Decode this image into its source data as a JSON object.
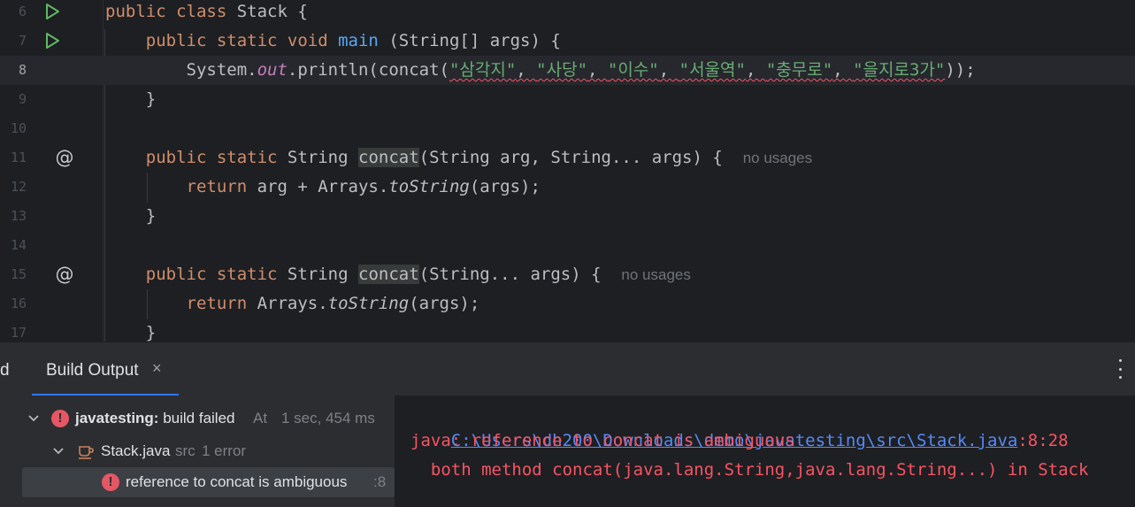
{
  "editor": {
    "lines": [
      {
        "num": "6",
        "gutter": "run",
        "parts": [
          [
            "kw",
            "public class "
          ],
          [
            "plain",
            "Stack {"
          ]
        ]
      },
      {
        "num": "7",
        "gutter": "run",
        "parts": [
          [
            "plain",
            "    "
          ],
          [
            "kw",
            "public static void "
          ],
          [
            "fn",
            "main "
          ],
          [
            "plain",
            "(String[] args) {"
          ]
        ]
      },
      {
        "num": "8",
        "gutter": "",
        "current": true,
        "parts": [
          [
            "plain",
            "        System."
          ],
          [
            "sfield",
            "out"
          ],
          [
            "plain",
            ".println("
          ],
          [
            "plain",
            "concat("
          ],
          [
            "strsq",
            "\"삼각지\""
          ],
          [
            "sqplain",
            ", "
          ],
          [
            "strsq",
            "\"사당\""
          ],
          [
            "sqplain",
            ", "
          ],
          [
            "strsq",
            "\"이수\""
          ],
          [
            "sqplain",
            ", "
          ],
          [
            "strsq",
            "\"서울역\""
          ],
          [
            "sqplain",
            ", "
          ],
          [
            "strsq",
            "\"충무로\""
          ],
          [
            "sqplain",
            ", "
          ],
          [
            "strsq",
            "\"을지로3가\""
          ],
          [
            "plain",
            ")"
          ],
          [
            "plain",
            ");"
          ]
        ]
      },
      {
        "num": "9",
        "gutter": "",
        "parts": [
          [
            "plain",
            "    }"
          ]
        ]
      },
      {
        "num": "10",
        "gutter": "",
        "parts": []
      },
      {
        "num": "11",
        "gutter": "at",
        "parts": [
          [
            "plain",
            "    "
          ],
          [
            "kw",
            "public static "
          ],
          [
            "plain",
            "String "
          ],
          [
            "hl",
            "concat"
          ],
          [
            "plain",
            "(String arg, String... args) {  "
          ],
          [
            "hint",
            "no usages"
          ]
        ]
      },
      {
        "num": "12",
        "gutter": "",
        "parts": [
          [
            "plain",
            "        "
          ],
          [
            "kw",
            "return "
          ],
          [
            "plain",
            "arg + Arrays."
          ],
          [
            "ital",
            "toString"
          ],
          [
            "plain",
            "(args);"
          ]
        ]
      },
      {
        "num": "13",
        "gutter": "",
        "parts": [
          [
            "plain",
            "    }"
          ]
        ]
      },
      {
        "num": "14",
        "gutter": "",
        "parts": []
      },
      {
        "num": "15",
        "gutter": "at",
        "parts": [
          [
            "plain",
            "    "
          ],
          [
            "kw",
            "public static "
          ],
          [
            "plain",
            "String "
          ],
          [
            "hl",
            "concat"
          ],
          [
            "plain",
            "(String... args) {  "
          ],
          [
            "hint",
            "no usages"
          ]
        ]
      },
      {
        "num": "16",
        "gutter": "",
        "parts": [
          [
            "plain",
            "        "
          ],
          [
            "kw",
            "return "
          ],
          [
            "plain",
            "Arrays."
          ],
          [
            "ital",
            "toString"
          ],
          [
            "plain",
            "(args);"
          ]
        ]
      },
      {
        "num": "17",
        "gutter": "",
        "parts": [
          [
            "plain",
            "    }"
          ]
        ]
      }
    ]
  },
  "toolwindow": {
    "prev_tab_fragment": "d",
    "tab_label": "Build Output",
    "close_symbol": "×"
  },
  "tree": {
    "root": {
      "name": "javatesting:",
      "status": " build failed",
      "time_prefix": "At ",
      "time": "1 sec, 454 ms"
    },
    "file": {
      "name": "Stack.java",
      "dir": "src",
      "count": "1 error"
    },
    "error": {
      "message": "reference to concat is ambiguous",
      "line": ":8"
    }
  },
  "output": {
    "path": "C:\\Users\\dh200\\Downloads\\demo\\javatesting\\src\\Stack.java",
    "location": ":8:28",
    "error_line": "java: reference to concat is ambiguous",
    "detail_line": "  both method concat(java.lang.String,java.lang.String...) in Stack"
  }
}
